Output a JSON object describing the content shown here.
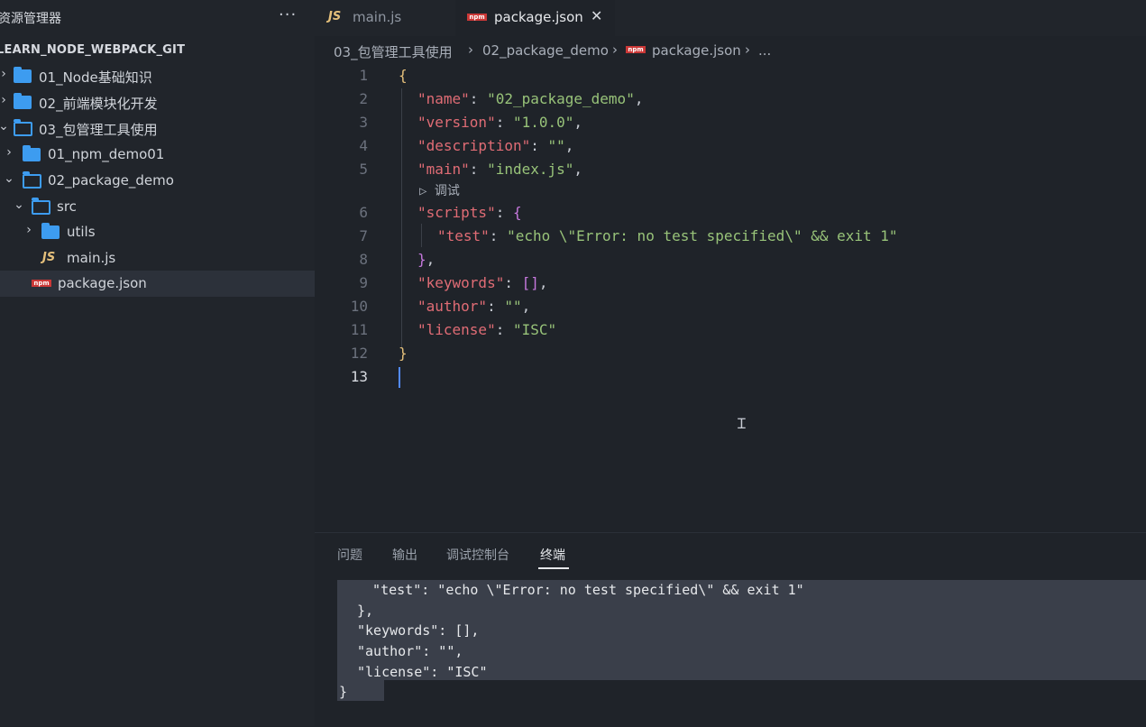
{
  "sidebar": {
    "title": "资源管理器",
    "more": "···",
    "project": "LEARN_NODE_WEBPACK_GIT",
    "items": [
      {
        "label": "01_Node基础知识",
        "type": "folder"
      },
      {
        "label": "02_前端模块化开发",
        "type": "folder"
      },
      {
        "label": "03_包管理工具使用",
        "type": "folder-open"
      },
      {
        "label": "01_npm_demo01",
        "type": "folder"
      },
      {
        "label": "02_package_demo",
        "type": "folder-open"
      },
      {
        "label": "src",
        "type": "folder-open"
      },
      {
        "label": "utils",
        "type": "folder"
      },
      {
        "label": "main.js",
        "type": "js"
      },
      {
        "label": "package.json",
        "type": "npm",
        "selected": true
      }
    ]
  },
  "icons": {
    "js": "JS",
    "npm": "npm"
  },
  "tabs": [
    {
      "label": "main.js",
      "active": false
    },
    {
      "label": "package.json",
      "active": true,
      "close": "✕"
    }
  ],
  "breadcrumb": {
    "parts": [
      "03_包管理工具使用",
      "02_package_demo",
      "package.json",
      "..."
    ],
    "sep": "›"
  },
  "editor": {
    "line_numbers": [
      "1",
      "2",
      "3",
      "4",
      "5",
      "6",
      "7",
      "8",
      "9",
      "10",
      "11",
      "12",
      "13"
    ],
    "current_line": "13",
    "codelens": "▷ 调试",
    "code": {
      "open": "{",
      "k_name": "\"name\"",
      "v_name": "\"02_package_demo\"",
      "k_version": "\"version\"",
      "v_version": "\"1.0.0\"",
      "k_description": "\"description\"",
      "v_description": "\"\"",
      "k_main": "\"main\"",
      "v_main": "\"index.js\"",
      "k_scripts": "\"scripts\"",
      "scripts_open": "{",
      "k_test": "\"test\"",
      "v_test": "\"echo \\\"Error: no test specified\\\" && exit 1\"",
      "scripts_close": "}",
      "k_keywords": "\"keywords\"",
      "v_keywords": "[]",
      "k_author": "\"author\"",
      "v_author": "\"\"",
      "k_license": "\"license\"",
      "v_license": "\"ISC\"",
      "close": "}",
      "colon": ": ",
      "comma": ","
    }
  },
  "panel": {
    "tabs": [
      "问题",
      "输出",
      "调试控制台",
      "终端"
    ],
    "active_tab": "终端",
    "terminal_lines": [
      "  \"test\": \"echo \\\"Error: no test specified\\\" && exit 1\"",
      "},",
      "\"keywords\": [],",
      "\"author\": \"\",",
      "\"license\": \"ISC\"",
      "}"
    ]
  },
  "colors": {
    "key": "#e06c75",
    "string": "#98c379",
    "brace": "#e5c07b",
    "folder": "#3d9cf0",
    "npm": "#cb3837",
    "js": "#e5c07b"
  }
}
